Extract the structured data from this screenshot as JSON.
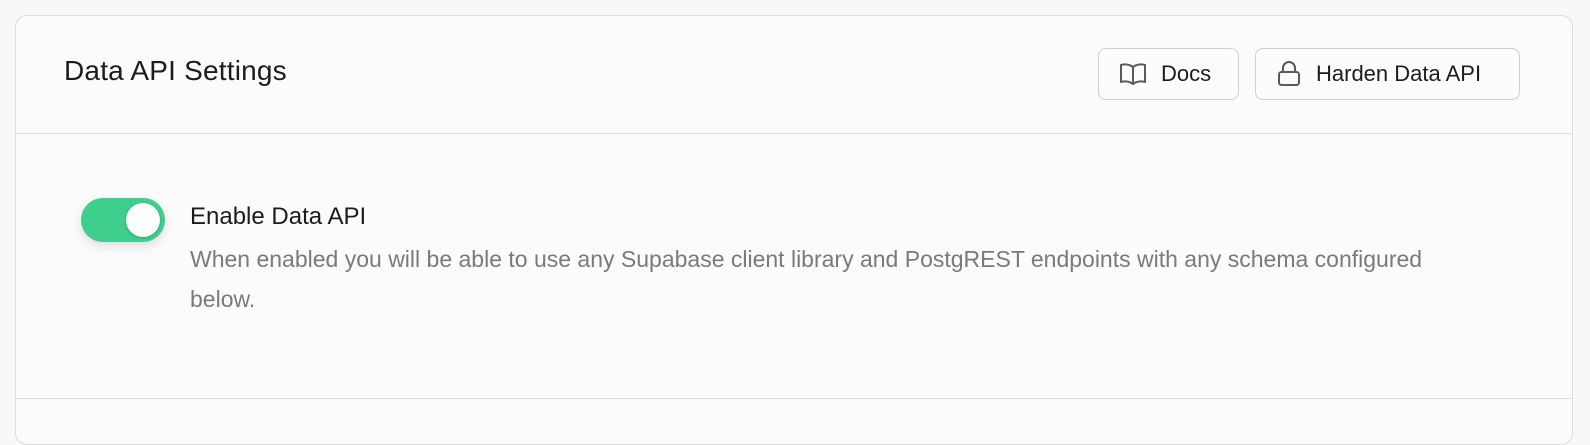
{
  "header": {
    "title": "Data API Settings",
    "docs_label": "Docs",
    "harden_label": "Harden Data API"
  },
  "setting": {
    "label": "Enable Data API",
    "description": "When enabled you will be able to use any Supabase client library and PostgREST endpoints with any schema configured below.",
    "enabled": true
  },
  "colors": {
    "toggle_on": "#3ecf8e"
  },
  "icons": {
    "docs": "book-icon",
    "harden": "lock-icon"
  }
}
